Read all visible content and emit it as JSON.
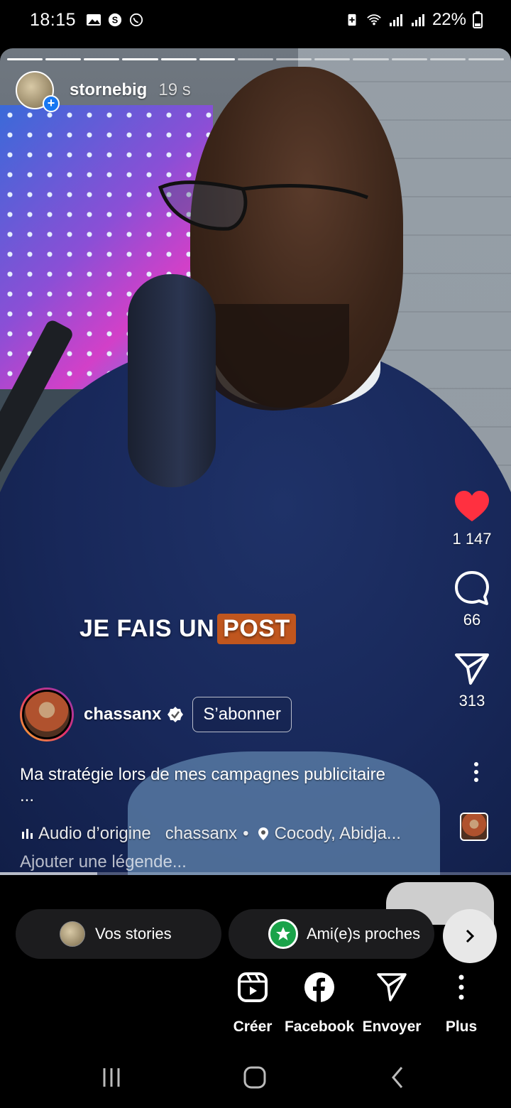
{
  "status_bar": {
    "time": "18:15",
    "battery": "22%"
  },
  "story": {
    "author": "stornebig",
    "age": "19 s",
    "overlay_text": "JE FAIS UN",
    "overlay_highlight": "POST",
    "reel_author": "chassanx",
    "follow_label": "S’abonner",
    "caption": "Ma stratégie lors de mes campagnes publicitaire",
    "caption_ellipsis": "...",
    "audio_label": "Audio d’origine",
    "audio_author": "chassanx",
    "separator": "•",
    "location": "Cocody, Abidja...",
    "add_caption_placeholder": "Ajouter une légende...",
    "likes": "1 147",
    "comments": "66",
    "shares": "313",
    "progress": 0.19
  },
  "share": {
    "your_stories": "Vos stories",
    "close_friends": "Ami(e)s proches",
    "items": [
      {
        "label": "Créer",
        "icon": "reels-icon"
      },
      {
        "label": "Facebook",
        "icon": "facebook-icon"
      },
      {
        "label": "Envoyer",
        "icon": "send-icon"
      },
      {
        "label": "Plus",
        "icon": "more-icon"
      }
    ]
  },
  "colors": {
    "like": "#ff3040",
    "close_friends": "#1aa34a",
    "accent_blue": "#1877f2"
  }
}
